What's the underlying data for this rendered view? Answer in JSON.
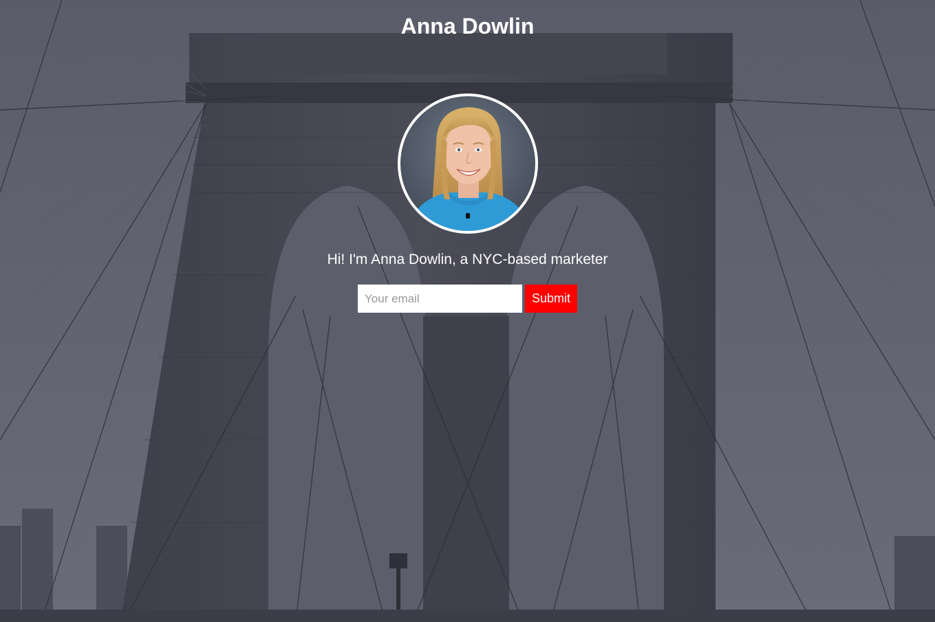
{
  "header": {
    "title": "Anna Dowlin"
  },
  "profile": {
    "avatar_icon": "portrait-photo",
    "tagline": "Hi! I'm Anna Dowlin, a NYC-based marketer"
  },
  "signup": {
    "email_value": "",
    "email_placeholder": "Your email",
    "submit_label": "Submit"
  },
  "colors": {
    "background_overlay": "#4a4b58",
    "submit_button": "#ff0000",
    "text": "#ffffff",
    "avatar_ring": "#ffffff"
  }
}
